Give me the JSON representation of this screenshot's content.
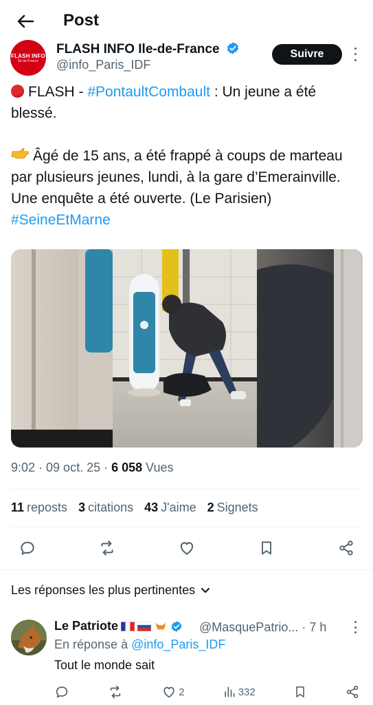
{
  "header": {
    "title": "Post"
  },
  "author": {
    "avatar_line1": "FLASH INFO",
    "avatar_line2": "Île-de-France",
    "name": "FLASH INFO Ile-de-France",
    "handle": "@info_Paris_IDF",
    "follow_label": "Suivre"
  },
  "tweet": {
    "line1_prefix": "FLASH - ",
    "line1_hashtag": "#PontaultCombault",
    "line1_suffix": " : Un jeune a été blessé.",
    "line2_text": "Âgé de 15 ans, a été frappé à coups de marteau par plusieurs jeunes, lundi, à la gare d’Emerainville. Une enquête a été ouverte. (Le Parisien) ",
    "line2_hashtag": "#SeineEtMarne"
  },
  "meta": {
    "time": "9:02 · 09 oct. 25 · ",
    "views_count": "6 058",
    "views_label": " Vues"
  },
  "stats": [
    {
      "count": "11",
      "label": "reposts"
    },
    {
      "count": "3",
      "label": "citations"
    },
    {
      "count": "43",
      "label": "J'aime"
    },
    {
      "count": "2",
      "label": "Signets"
    }
  ],
  "replies_header": {
    "label": "Les réponses les plus pertinentes"
  },
  "reply": {
    "name": "Le Patriote",
    "handle": "@MasquePatrio... · 7 h",
    "in_reply_prefix": "En réponse à ",
    "in_reply_handle": "@info_Paris_IDF",
    "text": "Tout le monde sait",
    "likes": "2",
    "views": "332"
  },
  "colors": {
    "accent": "#1d9bf0",
    "text": "#0f1419",
    "muted": "#536471",
    "brand_red": "#d40014"
  },
  "icons": {
    "back": "arrow-left-icon",
    "verified": "verified-badge-icon",
    "reply": "comment-icon",
    "repost": "repost-icon",
    "like": "heart-icon",
    "bookmark": "bookmark-icon",
    "share": "share-icon",
    "views": "views-bar-icon"
  }
}
